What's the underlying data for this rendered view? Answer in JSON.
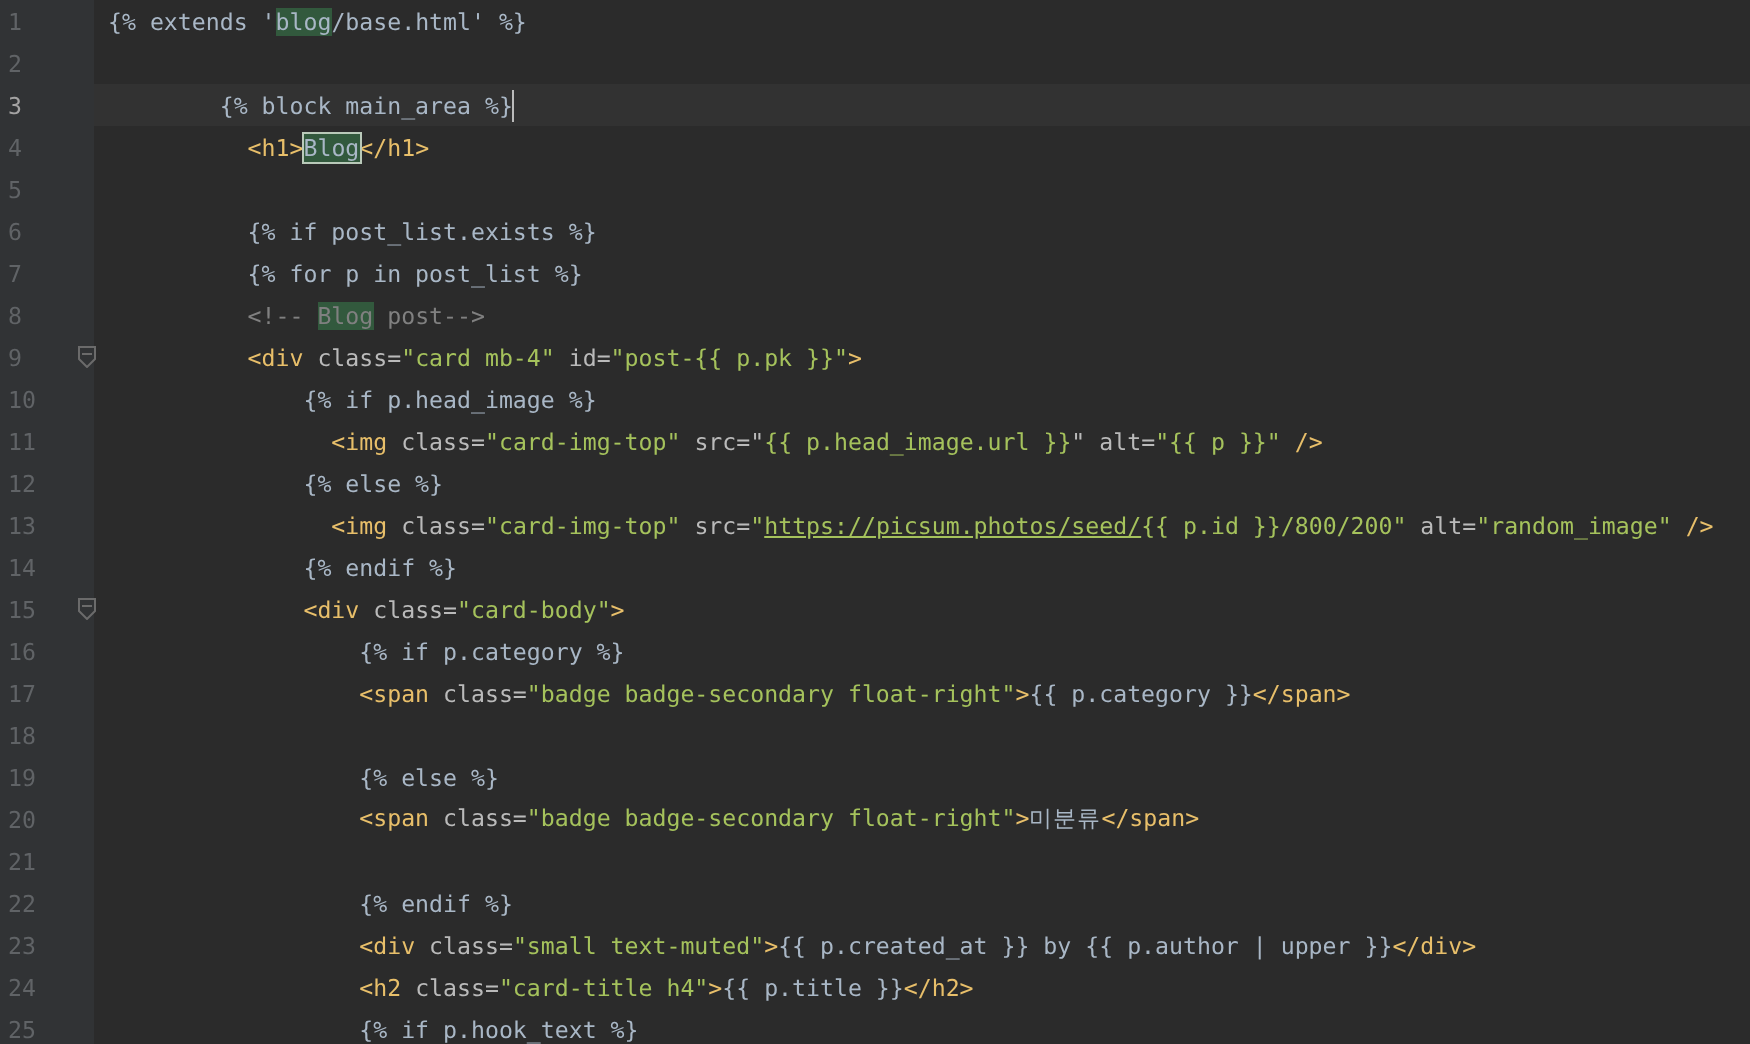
{
  "editor": {
    "lines": [
      {
        "number": "1",
        "current": false,
        "fold": false,
        "tokens": [
          {
            "kind": "tpl",
            "text": "{% extends '"
          },
          {
            "kind": "match",
            "text": "blog"
          },
          {
            "kind": "tpl",
            "text": "/base.html' %}"
          }
        ]
      },
      {
        "number": "2",
        "current": false,
        "fold": false
      },
      {
        "number": "3",
        "current": true,
        "fold": false,
        "tokens": [
          {
            "kind": "tpl",
            "text": "        {% block main_area %}"
          }
        ]
      },
      {
        "number": "4",
        "current": false,
        "fold": false,
        "tokens": [
          {
            "kind": "tag",
            "text": "          <h1>"
          },
          {
            "kind": "match-boxed",
            "text": "Blog"
          },
          {
            "kind": "tag",
            "text": "</h1>"
          }
        ]
      },
      {
        "number": "5",
        "current": false,
        "fold": false
      },
      {
        "number": "6",
        "current": false,
        "fold": false,
        "tokens": [
          {
            "kind": "tpl",
            "text": "          {% if post_list.exists %}"
          }
        ]
      },
      {
        "number": "7",
        "current": false,
        "fold": false,
        "tokens": [
          {
            "kind": "tpl",
            "text": "          {% for p in post_list %}"
          }
        ]
      },
      {
        "number": "8",
        "current": false,
        "fold": false,
        "tokens": [
          {
            "kind": "comment",
            "text": "          <!-- "
          },
          {
            "kind": "match-comment",
            "text": "Blog"
          },
          {
            "kind": "comment",
            "text": " post-->"
          }
        ]
      },
      {
        "number": "9",
        "current": false,
        "fold": true,
        "tokens": [
          {
            "kind": "tag",
            "text": "          <div "
          },
          {
            "kind": "attr",
            "text": "class="
          },
          {
            "kind": "str",
            "text": "\"card mb-4\""
          },
          {
            "kind": "attr",
            "text": " id="
          },
          {
            "kind": "str",
            "text": "\"post-{{ p.pk }}\""
          },
          {
            "kind": "tag",
            "text": ">"
          }
        ]
      },
      {
        "number": "10",
        "current": false,
        "fold": false,
        "tokens": [
          {
            "kind": "tpl",
            "text": "              {% if p.head_image %}"
          }
        ]
      },
      {
        "number": "11",
        "current": false,
        "fold": false,
        "tokens": [
          {
            "kind": "tag",
            "text": "                <img "
          },
          {
            "kind": "attr",
            "text": "class="
          },
          {
            "kind": "str",
            "text": "\"card-img-top\""
          },
          {
            "kind": "attr",
            "text": " src=\""
          },
          {
            "kind": "str",
            "text": "{{ p.head_image.url }}"
          },
          {
            "kind": "attr",
            "text": "\" alt="
          },
          {
            "kind": "str",
            "text": "\"{{ p }}\""
          },
          {
            "kind": "tag",
            "text": " />"
          }
        ]
      },
      {
        "number": "12",
        "current": false,
        "fold": false,
        "tokens": [
          {
            "kind": "tpl",
            "text": "              {% else %}"
          }
        ]
      },
      {
        "number": "13",
        "current": false,
        "fold": false,
        "tokens": [
          {
            "kind": "tag",
            "text": "                <img "
          },
          {
            "kind": "attr",
            "text": "class="
          },
          {
            "kind": "str",
            "text": "\"card-img-top\""
          },
          {
            "kind": "attr",
            "text": " src="
          },
          {
            "kind": "str",
            "text": "\""
          },
          {
            "kind": "url",
            "text": "https://picsum.photos/seed/"
          },
          {
            "kind": "str",
            "text": "{{ p.id }}/800/200\""
          },
          {
            "kind": "attr",
            "text": " alt="
          },
          {
            "kind": "str",
            "text": "\"random_image\""
          },
          {
            "kind": "tag",
            "text": " />"
          }
        ]
      },
      {
        "number": "14",
        "current": false,
        "fold": false,
        "tokens": [
          {
            "kind": "tpl",
            "text": "              {% endif %}"
          }
        ]
      },
      {
        "number": "15",
        "current": false,
        "fold": true,
        "tokens": [
          {
            "kind": "tag",
            "text": "              <div "
          },
          {
            "kind": "attr",
            "text": "class="
          },
          {
            "kind": "str",
            "text": "\"card-body\""
          },
          {
            "kind": "tag",
            "text": ">"
          }
        ]
      },
      {
        "number": "16",
        "current": false,
        "fold": false,
        "tokens": [
          {
            "kind": "tpl",
            "text": "                  {% if p.category %}"
          }
        ]
      },
      {
        "number": "17",
        "current": false,
        "fold": false,
        "tokens": [
          {
            "kind": "tag",
            "text": "                  <span "
          },
          {
            "kind": "attr",
            "text": "class="
          },
          {
            "kind": "str",
            "text": "\"badge badge-secondary float-right\""
          },
          {
            "kind": "tag",
            "text": ">"
          },
          {
            "kind": "tpl",
            "text": "{{ p.category }}"
          },
          {
            "kind": "tag",
            "text": "</span>"
          }
        ]
      },
      {
        "number": "18",
        "current": false,
        "fold": false
      },
      {
        "number": "19",
        "current": false,
        "fold": false,
        "tokens": [
          {
            "kind": "tpl",
            "text": "                  {% else %}"
          }
        ]
      },
      {
        "number": "20",
        "current": false,
        "fold": false,
        "tokens": [
          {
            "kind": "tag",
            "text": "                  <span "
          },
          {
            "kind": "attr",
            "text": "class="
          },
          {
            "kind": "str",
            "text": "\"badge badge-secondary float-right\""
          },
          {
            "kind": "tag",
            "text": ">"
          },
          {
            "kind": "tpl",
            "text": "미분류"
          },
          {
            "kind": "tag",
            "text": "</span>"
          }
        ]
      },
      {
        "number": "21",
        "current": false,
        "fold": false
      },
      {
        "number": "22",
        "current": false,
        "fold": false,
        "tokens": [
          {
            "kind": "tpl",
            "text": "                  {% endif %}"
          }
        ]
      },
      {
        "number": "23",
        "current": false,
        "fold": false,
        "tokens": [
          {
            "kind": "tag",
            "text": "                  <div "
          },
          {
            "kind": "attr",
            "text": "class="
          },
          {
            "kind": "str",
            "text": "\"small text-muted\""
          },
          {
            "kind": "tag",
            "text": ">"
          },
          {
            "kind": "tpl",
            "text": "{{ p.created_at }} by {{ p.author | upper }}"
          },
          {
            "kind": "tag",
            "text": "</div>"
          }
        ]
      },
      {
        "number": "24",
        "current": false,
        "fold": false,
        "tokens": [
          {
            "kind": "tag",
            "text": "                  <h2 "
          },
          {
            "kind": "attr",
            "text": "class="
          },
          {
            "kind": "str",
            "text": "\"card-title h4\""
          },
          {
            "kind": "tag",
            "text": ">"
          },
          {
            "kind": "tpl",
            "text": "{{ p.title }}"
          },
          {
            "kind": "tag",
            "text": "</h2>"
          }
        ]
      },
      {
        "number": "25",
        "current": false,
        "fold": false,
        "tokens": [
          {
            "kind": "tpl",
            "text": "                  {% if p.hook_text %}"
          }
        ]
      }
    ]
  }
}
